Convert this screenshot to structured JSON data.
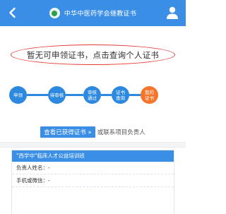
{
  "header": {
    "title": "中华中医药学会继教证书"
  },
  "notice": {
    "text": "暂无可申领证书，点击查询个人证书"
  },
  "steps": [
    {
      "label": "申领"
    },
    {
      "label": "待审核"
    },
    {
      "label": "审核\n通过"
    },
    {
      "label": "证书\n查询"
    },
    {
      "label": "我的\n证书"
    }
  ],
  "links": {
    "view_button": "查看已获得证书 »",
    "or_contact": "或联系项目负责人"
  },
  "card": {
    "title": "\"西学中\"临床人才公益培训班",
    "contact_name": "负责人姓名：-",
    "contact_phone": "手机或微信：-"
  },
  "colors": {
    "primary": "#3a8ee6",
    "active_step": "#f5752a",
    "notice_border": "#e53935"
  }
}
